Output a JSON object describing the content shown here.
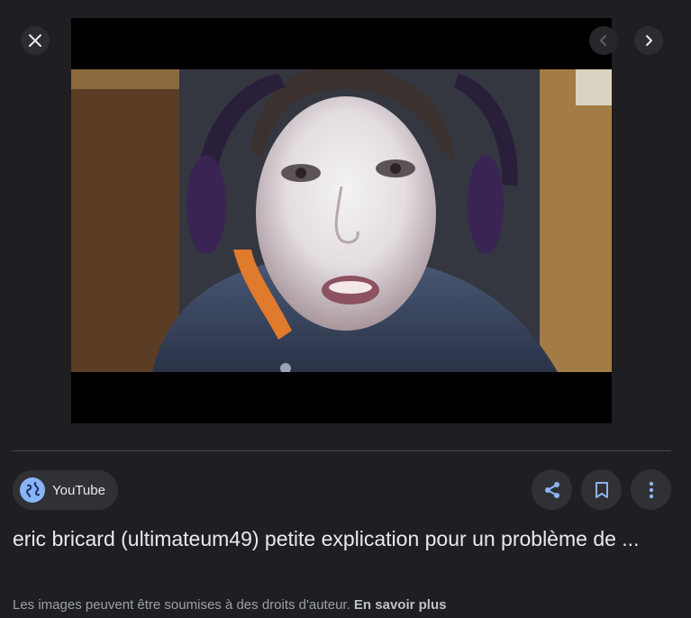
{
  "viewer": {
    "close_icon": "close-icon",
    "prev_icon": "chevron-left-icon",
    "next_icon": "chevron-right-icon"
  },
  "source": {
    "name": "YouTube",
    "icon": "globe-icon"
  },
  "actions": {
    "share_icon": "share-icon",
    "save_icon": "bookmark-icon",
    "more_icon": "more-vert-icon"
  },
  "result": {
    "title": "eric bricard (ultimateum49) petite explication pour un problème de ..."
  },
  "footer": {
    "copyright_text": "Les images peuvent être soumises à des droits d'auteur.",
    "learn_more": "En savoir plus"
  },
  "colors": {
    "background": "#1f1f23",
    "chip": "#303134",
    "accent": "#8ab4f8",
    "text": "#e8eaed",
    "muted_text": "#9aa0a6"
  }
}
